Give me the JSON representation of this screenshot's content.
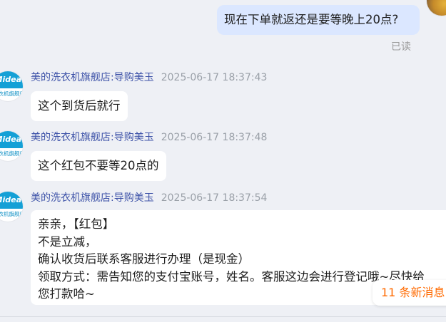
{
  "outgoing": {
    "text": "现在下单就返还是要等晚上20点?",
    "read_status": "已读"
  },
  "store_avatar": {
    "brand": "Midea",
    "sub": "洗衣机旗舰店"
  },
  "messages": [
    {
      "sender": "美的洗衣机旗舰店:导购美玉",
      "time": "2025-06-17 18:37:43",
      "lines": [
        "这个到货后就行"
      ]
    },
    {
      "sender": "美的洗衣机旗舰店:导购美玉",
      "time": "2025-06-17 18:37:48",
      "lines": [
        "这个红包不要等20点的"
      ]
    },
    {
      "sender": "美的洗衣机旗舰店:导购美玉",
      "time": "2025-06-17 18:37:54",
      "lines": [
        "亲亲，【红包】",
        "不是立减，",
        "确认收货后联系客服进行办理（是现金）",
        "领取方式：需告知您的支付宝账号，姓名。客服这边会进行登记哦~尽快给",
        "您打款哈~"
      ]
    }
  ],
  "new_messages": "11 条新消息"
}
